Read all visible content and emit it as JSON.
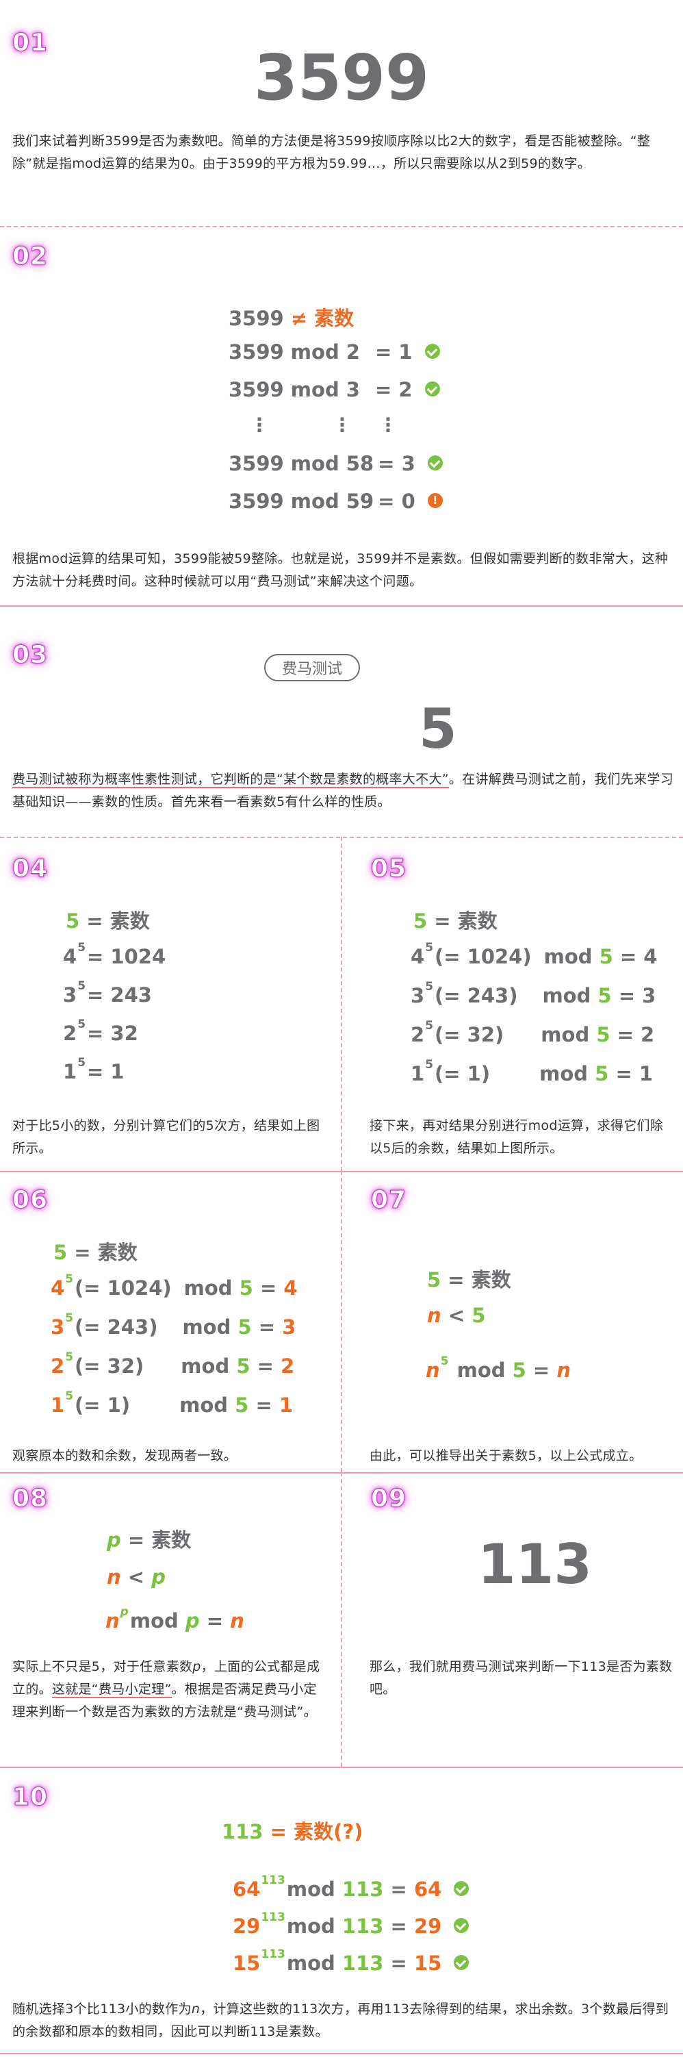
{
  "s01": {
    "num": "01",
    "big": "3599",
    "para": "我们来试着判断3599是否为素数吧。简单的方法便是将3599按顺序除以比2大的数字，看是否能被整除。“整除”就是指mod运算的结果为0。由于3599的平方根为59.99…，所以只需要除以从2到59的数字。"
  },
  "s02": {
    "num": "02",
    "head_left": "3599",
    "head_op": "≠",
    "head_right": "素数",
    "rows": [
      {
        "expr": "3599 mod 2",
        "res": "= 1"
      },
      {
        "expr": "3599 mod 3",
        "res": "= 2"
      },
      {
        "expr": "3599 mod 58",
        "res": "= 3"
      },
      {
        "expr": "3599 mod 59",
        "res": "= 0"
      }
    ],
    "vdots": "⋮",
    "warn_glyph": "!",
    "para": "根据mod运算的结果可知，3599能被59整除。也就是说，3599并不是素数。但假如需要判断的数非常大，这种方法就十分耗费时间。这种时候就可以用“费马测试”来解决这个问题。"
  },
  "s03": {
    "num": "03",
    "pill": "费马测试",
    "big": "5",
    "para_a": "费马测试被称为概率性素性测试，它判断的是“某个数是素数的概率大不大”",
    "para_b": "。在讲解费马测试之前，我们先来学习基础知识——素数的性质。首先来看一看素数5有什么样的性质。"
  },
  "s04": {
    "num": "04",
    "l1_num": "5",
    "l1_eq": "=",
    "l1_txt": "素数",
    "rows": [
      {
        "b": "4",
        "e": "5",
        "r": "= 1024"
      },
      {
        "b": "3",
        "e": "5",
        "r": "= 243"
      },
      {
        "b": "2",
        "e": "5",
        "r": "= 32"
      },
      {
        "b": "1",
        "e": "5",
        "r": "= 1"
      }
    ],
    "para": "对于比5小的数，分别计算它们的5次方，结果如上图所示。"
  },
  "s05": {
    "num": "05",
    "l1_num": "5",
    "l1_eq": "=",
    "l1_txt": "素数",
    "rows": [
      {
        "b": "4",
        "e": "5",
        "p": "(= 1024)",
        "m": "mod",
        "n": "5",
        "r": "= 4"
      },
      {
        "b": "3",
        "e": "5",
        "p": "(= 243)",
        "m": "mod",
        "n": "5",
        "r": "= 3"
      },
      {
        "b": "2",
        "e": "5",
        "p": "(= 32)",
        "m": "mod",
        "n": "5",
        "r": "= 2"
      },
      {
        "b": "1",
        "e": "5",
        "p": "(= 1)",
        "m": "mod",
        "n": "5",
        "r": "= 1"
      }
    ],
    "para": "接下来，再对结果分别进行mod运算，求得它们除以5后的余数，结果如上图所示。"
  },
  "s06": {
    "num": "06",
    "l1_num": "5",
    "l1_eq": "=",
    "l1_txt": "素数",
    "rows": [
      {
        "b": "4",
        "e": "5",
        "p": "(= 1024)",
        "m": "mod",
        "n": "5",
        "eq": "=",
        "r": "4"
      },
      {
        "b": "3",
        "e": "5",
        "p": "(= 243)",
        "m": "mod",
        "n": "5",
        "eq": "=",
        "r": "3"
      },
      {
        "b": "2",
        "e": "5",
        "p": "(= 32)",
        "m": "mod",
        "n": "5",
        "eq": "=",
        "r": "2"
      },
      {
        "b": "1",
        "e": "5",
        "p": "(= 1)",
        "m": "mod",
        "n": "5",
        "eq": "=",
        "r": "1"
      }
    ],
    "para": "观察原本的数和余数，发现两者一致。"
  },
  "s07": {
    "num": "07",
    "l1_num": "5",
    "l1_eq": "=",
    "l1_txt": "素数",
    "l2_n": "n",
    "l2_op": "<",
    "l2_5": "5",
    "l3_n": "n",
    "l3_e": "5",
    "l3_mod": "mod",
    "l3_5": "5",
    "l3_eq": "=",
    "l3_r": "n",
    "para": "由此，可以推导出关于素数5，以上公式成立。"
  },
  "s08": {
    "num": "08",
    "l1_p": "p",
    "l1_eq": "=",
    "l1_txt": "素数",
    "l2_n": "n",
    "l2_op": "<",
    "l2_p": "p",
    "l3_n": "n",
    "l3_e": "p",
    "l3_mod": "mod",
    "l3_p": "p",
    "l3_eq": "=",
    "l3_r": "n",
    "para_a": "实际上不只是5，对于任意素数",
    "para_p": "p",
    "para_b": "，上面的公式都是成立的。",
    "para_u": "这就是“费马小定理”",
    "para_c": "。根据是否满足费马小定理来判断一个数是否为素数的方法就是“费马测试”。"
  },
  "s09": {
    "num": "09",
    "big": "113",
    "para": "那么，我们就用费马测试来判断一下113是否为素数吧。"
  },
  "s10": {
    "num": "10",
    "head_num": "113",
    "head_eq": "=",
    "head_txt": "素数(?)",
    "rows": [
      {
        "b": "64",
        "e": "113",
        "m": "mod",
        "n": "113",
        "eq": "=",
        "r": "64"
      },
      {
        "b": "29",
        "e": "113",
        "m": "mod",
        "n": "113",
        "eq": "=",
        "r": "29"
      },
      {
        "b": "15",
        "e": "113",
        "m": "mod",
        "n": "113",
        "eq": "=",
        "r": "15"
      }
    ],
    "para_a": "随机选择3个比113小的数作为",
    "para_n": "n",
    "para_b": "，计算这些数的113次方，再用113去除得到的结果，求出余数。3个数最后得到的余数都和原本的数相同，因此可以判断113是素数。"
  },
  "colors": {
    "gray": "#6d6e71",
    "orange": "#ee6b1f",
    "green": "#7cc242",
    "glow": "#d050d0",
    "line": "#f29aac"
  }
}
